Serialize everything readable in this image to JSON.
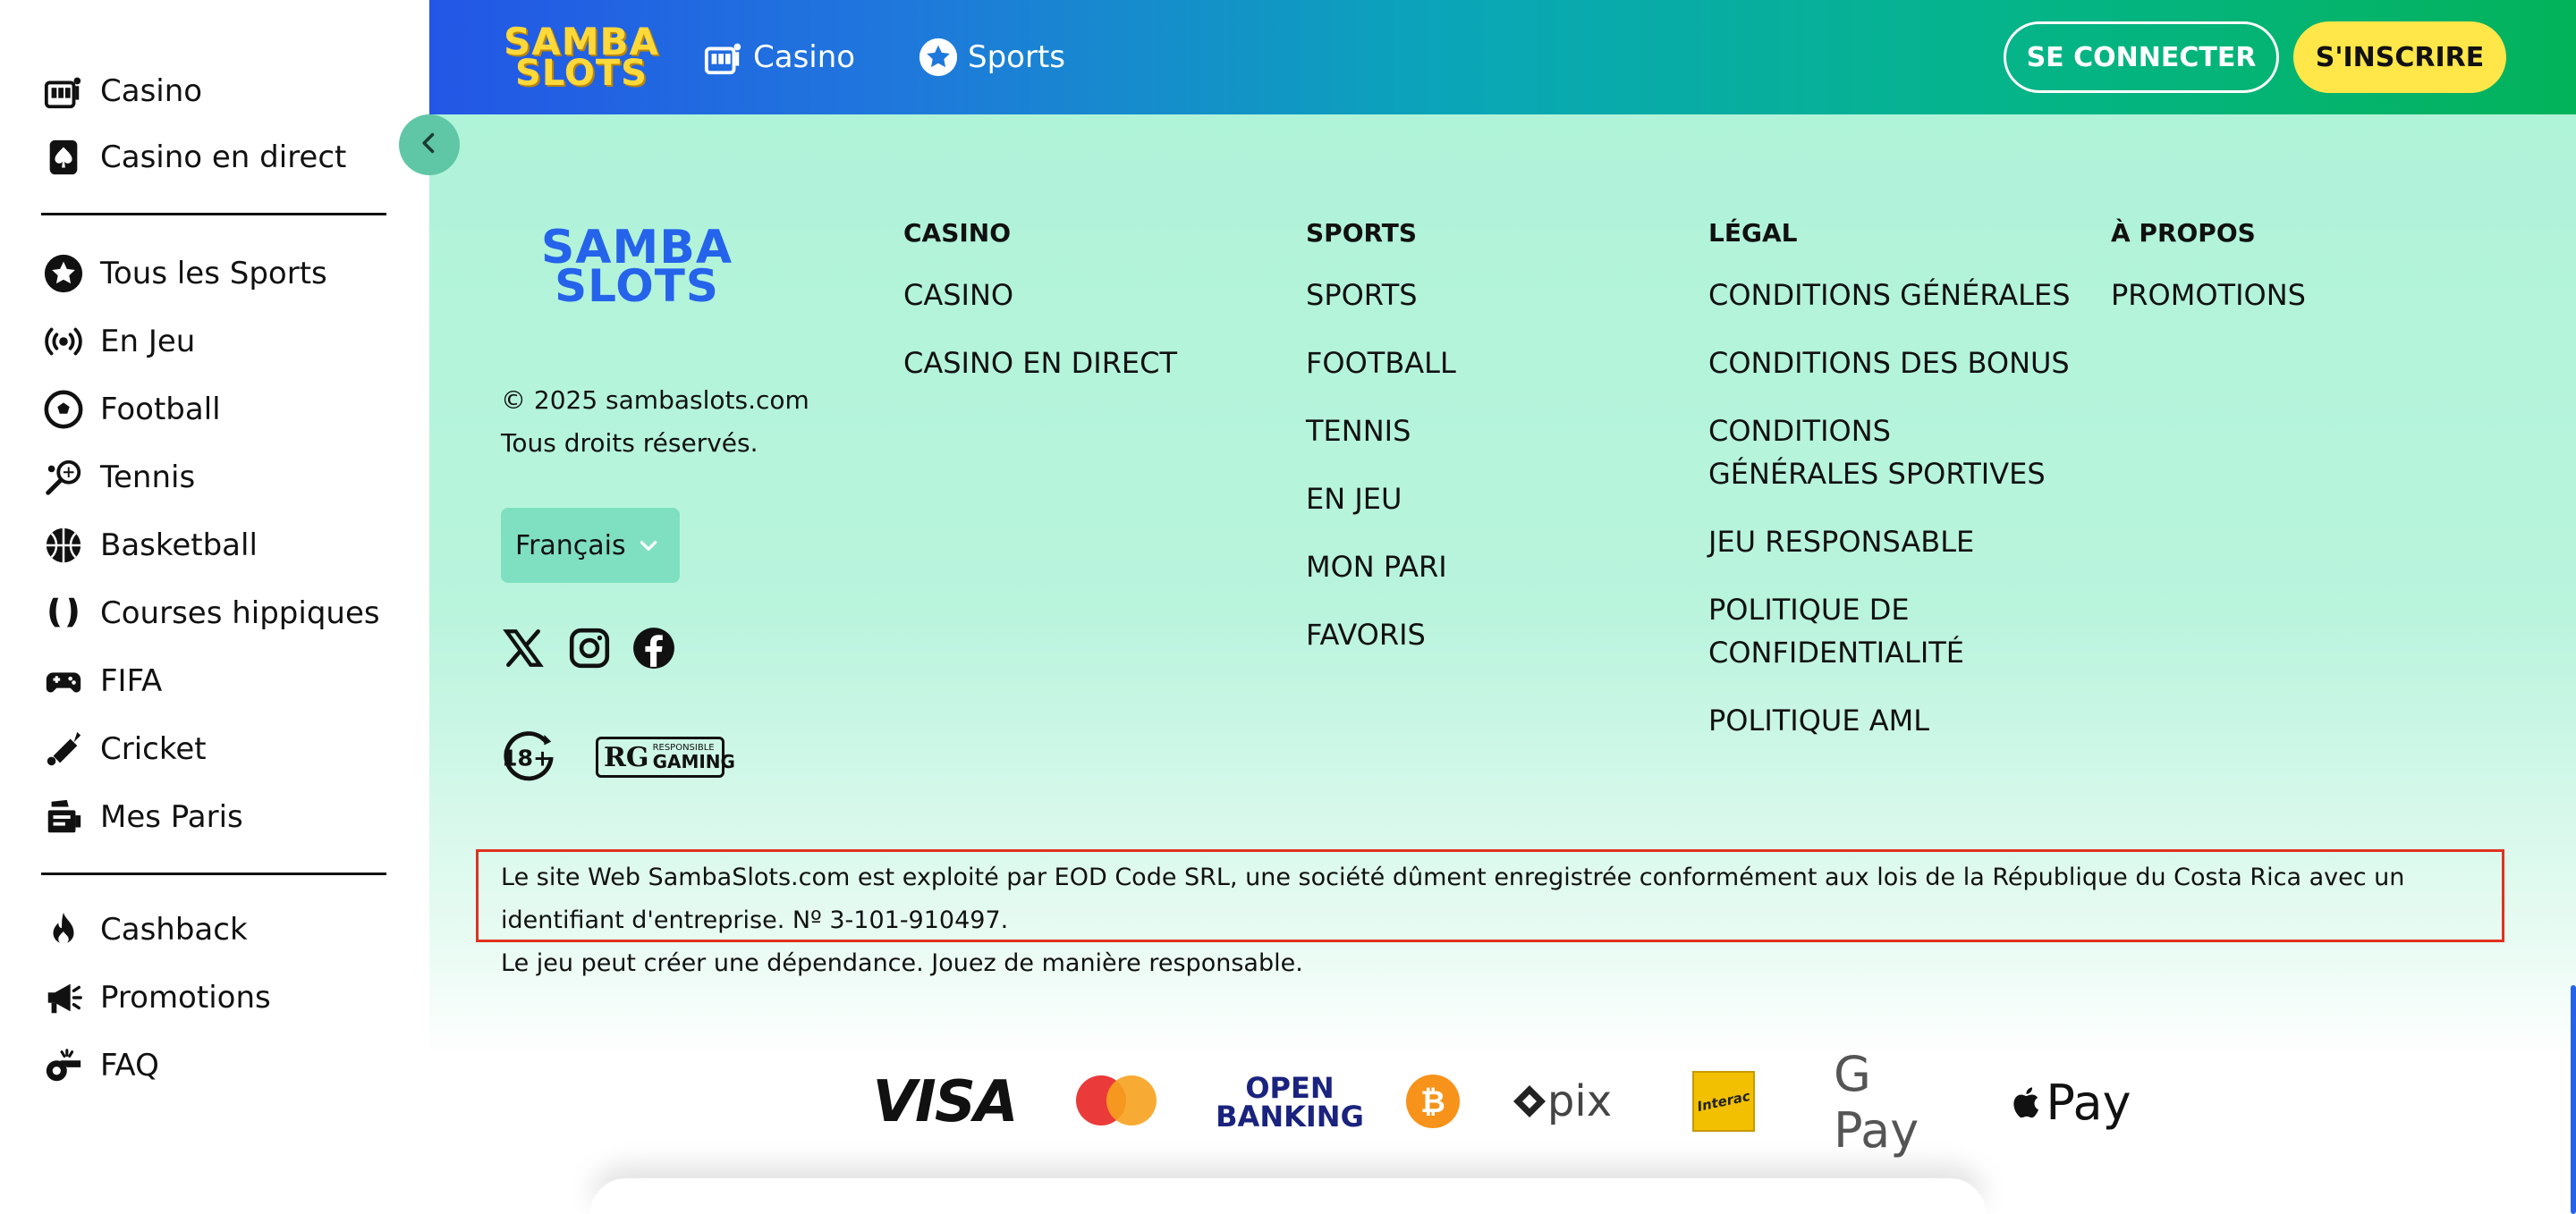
{
  "brand": {
    "logo_line1": "SAMBA",
    "logo_line2": "SLOTS"
  },
  "topbar": {
    "nav": [
      {
        "label": "Casino",
        "icon": "casino-icon"
      },
      {
        "label": "Sports",
        "icon": "star-icon"
      }
    ],
    "login_label": "SE CONNECTER",
    "signup_label": "S'INSCRIRE"
  },
  "sidebar": {
    "group1": [
      {
        "label": "Casino",
        "icon": "slot-machine-icon"
      },
      {
        "label": "Casino en direct",
        "icon": "spade-card-icon"
      }
    ],
    "group2": [
      {
        "label": "Tous les Sports",
        "icon": "star-badge-icon"
      },
      {
        "label": "En Jeu",
        "icon": "live-broadcast-icon"
      },
      {
        "label": "Football",
        "icon": "football-icon"
      },
      {
        "label": "Tennis",
        "icon": "tennis-racket-icon"
      },
      {
        "label": "Basketball",
        "icon": "basketball-icon"
      },
      {
        "label": "Courses hippiques",
        "icon": "horseshoe-icon"
      },
      {
        "label": "FIFA",
        "icon": "gamepad-icon"
      },
      {
        "label": "Cricket",
        "icon": "cricket-bat-icon"
      },
      {
        "label": "Mes Paris",
        "icon": "bet-slip-icon"
      }
    ],
    "group3": [
      {
        "label": "Cashback",
        "icon": "flame-icon"
      },
      {
        "label": "Promotions",
        "icon": "megaphone-icon"
      },
      {
        "label": "FAQ",
        "icon": "whistle-icon"
      }
    ]
  },
  "footer": {
    "copyright": "© 2025 sambaslots.com",
    "rights": "Tous droits réservés.",
    "language": "Français",
    "badges": {
      "age": "18+",
      "rg_mark": "RG",
      "rg_small": "RESPONSIBLE",
      "rg_big": "GAMING"
    },
    "columns": [
      {
        "title": "CASINO",
        "links": [
          "CASINO",
          "CASINO EN DIRECT"
        ]
      },
      {
        "title": "SPORTS",
        "links": [
          "SPORTS",
          "FOOTBALL",
          "TENNIS",
          "EN JEU",
          "MON PARI",
          "FAVORIS"
        ]
      },
      {
        "title": "LÉGAL",
        "links": [
          "CONDITIONS GÉNÉRALES",
          "CONDITIONS DES BONUS",
          "CONDITIONS GÉNÉRALES SPORTIVES",
          "JEU RESPONSABLE",
          "POLITIQUE DE CONFIDENTIALITÉ",
          "POLITIQUE AML"
        ]
      },
      {
        "title": "À PROPOS",
        "links": [
          "PROMOTIONS"
        ]
      }
    ],
    "legal_text": "Le site Web SambaSlots.com est exploité par EOD Code SRL, une société dûment enregistrée conformément aux lois de la République du Costa Rica avec un identifiant d'entreprise. Nº 3-101-910497.",
    "responsible_text": "Le jeu peut créer une dépendance. Jouez de manière responsable.",
    "payments": {
      "visa": "VISA",
      "openbanking_1": "OPEN",
      "openbanking_2": "BANKING",
      "pix": "pix",
      "interac": "Interac",
      "gpay": "G Pay",
      "apay": " Pay"
    }
  },
  "colors": {
    "topbar_start": "#2356e6",
    "topbar_end": "#03b35a",
    "footer_bg": "#aff3d9",
    "signup_bg": "#ffe649",
    "highlight_border": "#e0321e"
  }
}
